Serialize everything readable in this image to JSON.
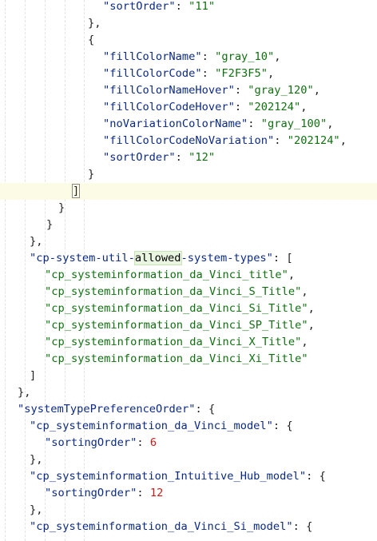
{
  "editor": {
    "current_line_index": 11,
    "colors": {
      "punct": "#1f1f1f",
      "key": "#0b2a86",
      "string": "#107010",
      "number": "#d01818",
      "current_line": "#fcfbe5",
      "highlight": "#e9f5e1"
    },
    "lines": [
      [
        {
          "t": "\"sortOrder\"",
          "k": "key"
        },
        {
          "t": ": ",
          "k": "punct"
        },
        {
          "t": "\"11\"",
          "k": "str"
        }
      ],
      [
        {
          "t": "},",
          "k": "punct"
        }
      ],
      [
        {
          "t": "{",
          "k": "punct"
        }
      ],
      [
        {
          "t": "\"fillColorName\"",
          "k": "key"
        },
        {
          "t": ": ",
          "k": "punct"
        },
        {
          "t": "\"gray_10\"",
          "k": "str"
        },
        {
          "t": ",",
          "k": "punct"
        }
      ],
      [
        {
          "t": "\"fillColorCode\"",
          "k": "key"
        },
        {
          "t": ": ",
          "k": "punct"
        },
        {
          "t": "\"F2F3F5\"",
          "k": "str"
        },
        {
          "t": ",",
          "k": "punct"
        }
      ],
      [
        {
          "t": "\"fillColorNameHover\"",
          "k": "key"
        },
        {
          "t": ": ",
          "k": "punct"
        },
        {
          "t": "\"gray_120\"",
          "k": "str"
        },
        {
          "t": ",",
          "k": "punct"
        }
      ],
      [
        {
          "t": "\"fillColorCodeHover\"",
          "k": "key"
        },
        {
          "t": ": ",
          "k": "punct"
        },
        {
          "t": "\"202124\"",
          "k": "str"
        },
        {
          "t": ",",
          "k": "punct"
        }
      ],
      [
        {
          "t": "\"noVariationColorName\"",
          "k": "key"
        },
        {
          "t": ": ",
          "k": "punct"
        },
        {
          "t": "\"gray_100\"",
          "k": "str"
        },
        {
          "t": ",",
          "k": "punct"
        }
      ],
      [
        {
          "t": "\"fillColorCodeNoVariation\"",
          "k": "key"
        },
        {
          "t": ": ",
          "k": "punct"
        },
        {
          "t": "\"202124\"",
          "k": "str"
        },
        {
          "t": ",",
          "k": "punct"
        }
      ],
      [
        {
          "t": "\"sortOrder\"",
          "k": "key"
        },
        {
          "t": ": ",
          "k": "punct"
        },
        {
          "t": "\"12\"",
          "k": "str"
        }
      ],
      [
        {
          "t": "}",
          "k": "punct"
        }
      ],
      [
        {
          "t": "]",
          "k": "bracket-match"
        }
      ],
      [
        {
          "t": "}",
          "k": "punct"
        }
      ],
      [
        {
          "t": "}",
          "k": "punct"
        }
      ],
      [
        {
          "t": "},",
          "k": "punct"
        }
      ],
      [
        {
          "t": "\"cp-system-util-",
          "k": "key"
        },
        {
          "t": "allowed",
          "k": "hl"
        },
        {
          "t": "-system-types\"",
          "k": "key"
        },
        {
          "t": ": [",
          "k": "punct"
        }
      ],
      [
        {
          "t": "\"cp_systeminformation_da_Vinci_title\"",
          "k": "str"
        },
        {
          "t": ",",
          "k": "punct"
        }
      ],
      [
        {
          "t": "\"cp_systeminformation_da_Vinci_S_Title\"",
          "k": "str"
        },
        {
          "t": ",",
          "k": "punct"
        }
      ],
      [
        {
          "t": "\"cp_systeminformation_da_Vinci_Si_Title\"",
          "k": "str"
        },
        {
          "t": ",",
          "k": "punct"
        }
      ],
      [
        {
          "t": "\"cp_systeminformation_da_Vinci_SP_Title\"",
          "k": "str"
        },
        {
          "t": ",",
          "k": "punct"
        }
      ],
      [
        {
          "t": "\"cp_systeminformation_da_Vinci_X_Title\"",
          "k": "str"
        },
        {
          "t": ",",
          "k": "punct"
        }
      ],
      [
        {
          "t": "\"cp_systeminformation_da_Vinci_Xi_Title\"",
          "k": "str"
        }
      ],
      [
        {
          "t": "]",
          "k": "punct"
        }
      ],
      [
        {
          "t": "},",
          "k": "punct"
        }
      ],
      [
        {
          "t": "\"systemTypePreferenceOrder\"",
          "k": "key"
        },
        {
          "t": ": {",
          "k": "punct"
        }
      ],
      [
        {
          "t": "\"cp_systeminformation_da_Vinci_model\"",
          "k": "key"
        },
        {
          "t": ": {",
          "k": "punct"
        }
      ],
      [
        {
          "t": "\"sortingOrder\"",
          "k": "key"
        },
        {
          "t": ": ",
          "k": "punct"
        },
        {
          "t": "6",
          "k": "num"
        }
      ],
      [
        {
          "t": "},",
          "k": "punct"
        }
      ],
      [
        {
          "t": "\"cp_systeminformation_Intuitive_Hub_model\"",
          "k": "key"
        },
        {
          "t": ": {",
          "k": "punct"
        }
      ],
      [
        {
          "t": "\"sortingOrder\"",
          "k": "key"
        },
        {
          "t": ": ",
          "k": "punct"
        },
        {
          "t": "12",
          "k": "num"
        }
      ],
      [
        {
          "t": "},",
          "k": "punct"
        }
      ],
      [
        {
          "t": "\"cp_systeminformation_da_Vinci_Si_model\"",
          "k": "key"
        },
        {
          "t": ": {",
          "k": "punct"
        }
      ]
    ]
  }
}
